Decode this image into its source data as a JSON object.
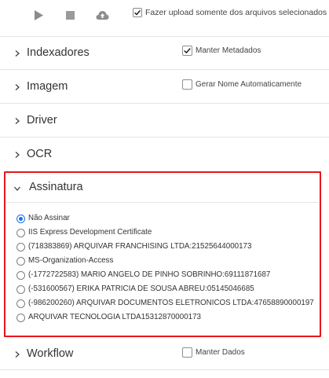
{
  "toolbar": {
    "upload_only_selected_label": "Fazer upload somente dos arquivos selecionados",
    "upload_only_selected_checked": true
  },
  "sections": {
    "indexadores": {
      "title": "Indexadores",
      "option_label": "Manter Metadados",
      "option_checked": true
    },
    "imagem": {
      "title": "Imagem",
      "option_label": "Gerar Nome Automaticamente",
      "option_checked": false
    },
    "driver": {
      "title": "Driver"
    },
    "ocr": {
      "title": "OCR"
    },
    "assinatura": {
      "title": "Assinatura",
      "selected_index": 0,
      "options": [
        "Não Assinar",
        "IIS Express Development Certificate",
        "(718383869) ARQUIVAR FRANCHISING LTDA:21525644000173",
        "MS-Organization-Access",
        "(-1772722583) MARIO ANGELO DE PINHO SOBRINHO:69111871687",
        "(-531600567) ERIKA PATRICIA DE SOUSA ABREU:05145046685",
        "(-986200260) ARQUIVAR DOCUMENTOS ELETRONICOS LTDA:47658890000197",
        "ARQUIVAR TECNOLOGIA LTDA15312870000173"
      ]
    },
    "workflow": {
      "title": "Workflow",
      "option_label": "Manter Dados",
      "option_checked": false
    }
  },
  "colors": {
    "highlight": "#e8161b",
    "radio_selected": "#1a73e8",
    "toolbar_icon": "#8c8c8c"
  }
}
